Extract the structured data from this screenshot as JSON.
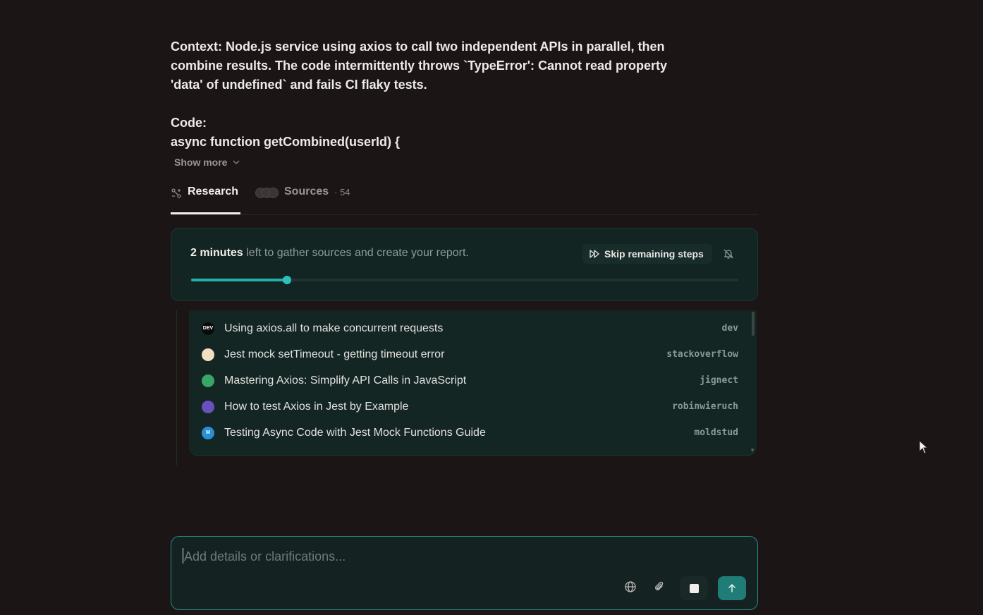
{
  "query": {
    "lines": [
      "Context: Node.js service using axios to call two independent APIs in parallel, then",
      "combine results. The code intermittently throws `TypeError': Cannot read property",
      "'data' of undefined` and fails CI flaky tests.",
      "Code:",
      "async function getCombined(userId) {"
    ],
    "show_more": "Show more"
  },
  "tabs": {
    "research": "Research",
    "sources": "Sources",
    "sources_count": "· 54"
  },
  "progress": {
    "time": "2 minutes",
    "rest": " left to gather sources and create your report.",
    "skip_label": "Skip remaining steps",
    "fraction": 0.175
  },
  "sources": [
    {
      "title": "Using axios.all to make concurrent requests",
      "domain": "dev",
      "icon": "dev-logo-icon",
      "icon_text": "DEV",
      "color": "#0a0a0a"
    },
    {
      "title": "Jest mock setTimeout - getting timeout error",
      "domain": "stackoverflow",
      "icon": "stackoverflow-logo-icon",
      "icon_text": "",
      "color": "#f4ddc3"
    },
    {
      "title": "Mastering Axios: Simplify API Calls in JavaScript",
      "domain": "jignect",
      "icon": "jignect-logo-icon",
      "icon_text": "",
      "color": "#3aa56b"
    },
    {
      "title": "How to test Axios in Jest by Example",
      "domain": "robinwieruch",
      "icon": "robinwieruch-logo-icon",
      "icon_text": "",
      "color": "#6a4fbf"
    },
    {
      "title": "Testing Async Code with Jest Mock Functions Guide",
      "domain": "moldstud",
      "icon": "moldstud-logo-icon",
      "icon_text": "M",
      "color": "#2a8fd6"
    }
  ],
  "composer": {
    "placeholder": "Add details or clarifications..."
  },
  "colors": {
    "accent": "#22b1aa",
    "send": "#1f7c77"
  }
}
